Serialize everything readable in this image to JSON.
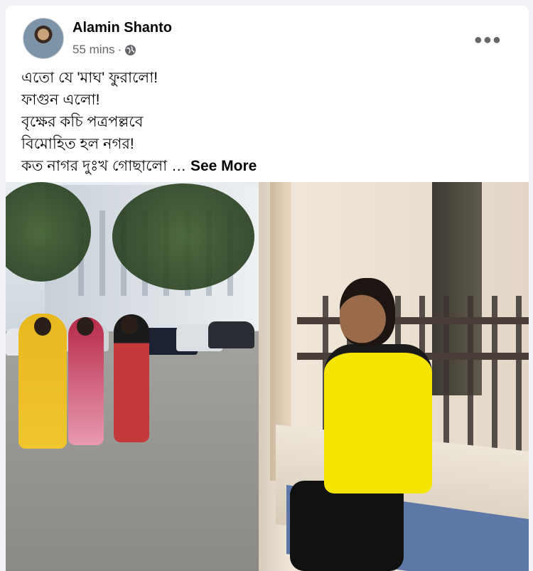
{
  "post": {
    "author": "Alamin Shanto",
    "time": "55 mins",
    "separator": "·",
    "privacy_icon": "globe-icon",
    "more_icon": "more-options-icon",
    "text_lines": [
      "এতো যে 'মাঘ' ফুরালো!",
      "ফাগুন এলো!",
      "বৃক্ষের কচি পত্রপল্লবে",
      "বিমোহিত হল নগর!",
      "কত নাগর দুঃখ গোছালো …"
    ],
    "see_more": "See More"
  },
  "colors": {
    "background": "#f0f2f5",
    "card": "#ffffff",
    "text": "#050505",
    "secondary": "#65676b"
  }
}
